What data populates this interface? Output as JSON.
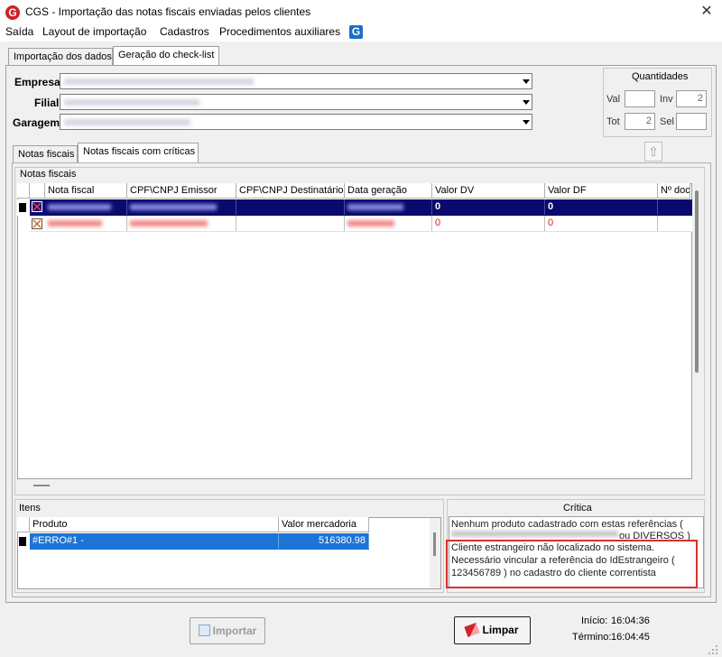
{
  "window": {
    "title": "CGS - Importação das notas fiscais enviadas pelos clientes",
    "icon_letter": "G"
  },
  "menu": {
    "items": [
      "Saída",
      "Layout de importação",
      "Cadastros",
      "Procedimentos auxiliares"
    ],
    "g_icon": "G"
  },
  "main_tabs": [
    "Importação dos dados",
    "Geração do check-list"
  ],
  "filters": {
    "empresa_label": "Empresa",
    "filial_label": "Filial",
    "garagem_label": "Garagem"
  },
  "quantidades": {
    "title": "Quantidades",
    "val_label": "Val",
    "val_value": "",
    "inv_label": "Inv",
    "inv_value": "2",
    "tot_label": "Tot",
    "tot_value": "2",
    "sel_label": "Sel",
    "sel_value": ""
  },
  "sub_tabs": [
    "Notas fiscais",
    "Notas fiscais com críticas"
  ],
  "notas": {
    "group_title": "Notas fiscais",
    "columns": [
      "Nota fiscal",
      "CPF\\CNPJ Emissor",
      "CPF\\CNPJ Destinatário",
      "Data geração",
      "Valor DV",
      "Valor DF",
      "Nº doc"
    ],
    "rows": [
      {
        "valor_dv": "0",
        "valor_df": "0"
      },
      {
        "valor_dv": "0",
        "valor_df": "0"
      }
    ]
  },
  "itens": {
    "group_title": "Itens",
    "columns": [
      "Produto",
      "Valor mercadoria"
    ],
    "rows": [
      {
        "produto": "#ERRO#1 -",
        "valor": "516380.98"
      }
    ]
  },
  "critica": {
    "title": "Crítica",
    "line1_a": "Nenhum produto cadastrado com estas referências (",
    "line2_b": "ou DIVERSOS )",
    "message": "Cliente estrangeiro não localizado no sistema. Necessário vincular a referência do IdEstrangeiro  ( 123456789 )  no cadastro do cliente correntista"
  },
  "buttons": {
    "importar": "Importar",
    "limpar": "Limpar"
  },
  "times": {
    "inicio_label": "Início:",
    "inicio_value": "16:04:36",
    "termino_label": "Término:",
    "termino_value": "16:04:45"
  },
  "colors": {
    "selection": "#0a0a6e",
    "error_red": "#e01818",
    "highlight_box": "#d9302c"
  }
}
